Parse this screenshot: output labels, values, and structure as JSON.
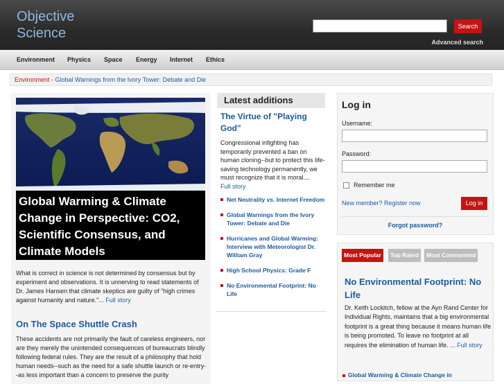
{
  "header": {
    "logo": [
      "Objective",
      "Science"
    ],
    "search_button": "Search",
    "advanced_search": "Advanced search"
  },
  "nav": [
    "Environment",
    "Physics",
    "Space",
    "Energy",
    "Internet",
    "Ethics"
  ],
  "breadcrumb": {
    "section": "Environment",
    "separator": " - ",
    "page": "Global Warnings from the Ivory Tower: Debate and Die"
  },
  "feature": {
    "title": "Global Warming & Climate Change in Perspective: CO2, Scientific Consensus, and Climate Models",
    "body": "What is correct in science is not determined by consensus but by experiment and observations. It is unnerving to read statements of Dr. James Hansen that climate skeptics are guilty of \"high crimes against humanity and nature.\"...",
    "more": "Full story"
  },
  "story2": {
    "title": "On The Space Shuttle Crash",
    "body": "These accidents are not primarily the fault of careless engineers, nor are they merely the unintended consequences of bureaucrats blindly following federal rules. They are the result of a philosophy that hold human needs--such as the need for a safe shuttle launch or re-entry--as less important than a concern to preserve the purity"
  },
  "latest": {
    "heading": "Latest additions",
    "lead_title": "The Virtue of \"Playing God\"",
    "lead_body": "Congressional infighting has temporarily prevented a ban on human cloning--but to protect this life-saving technology permanently, we must recognize that it is moral....",
    "lead_more": "Full story",
    "items": [
      "Net Neutrality vs. Internet Freedom",
      "Global Warnings from the Ivory Tower: Debate and Die",
      "Hurricanes and Global Warming: Interview with Meteorologist Dr. William Gray",
      "High School Physics: Grade F",
      "No Environmental Footprint: No Life"
    ]
  },
  "login": {
    "heading": "Log in",
    "username_label": "Username:",
    "password_label": "Password:",
    "remember": "Remember me",
    "register": "New member? Register now",
    "button": "Log in",
    "forgot": "Forgot password?"
  },
  "popular": {
    "tabs": [
      "Most Popular",
      "Top Rated",
      "Most Commented"
    ],
    "title": "No Environmental Footprint: No Life",
    "body": "Dr. Keith Lockitch, fellow at the Ayn Rand Center for Individual Rights, maintains that a big environmental footprint is a great thing because it means human life is being promoted. To leave no footprint at all requires the elimination of human life. ...",
    "more": "Full story",
    "next_item": "Global Warming & Climate Change in"
  },
  "colors": {
    "accent_red": "#c31414",
    "link_blue": "#1b5a9f",
    "logo_blue": "#8fb7e0"
  }
}
